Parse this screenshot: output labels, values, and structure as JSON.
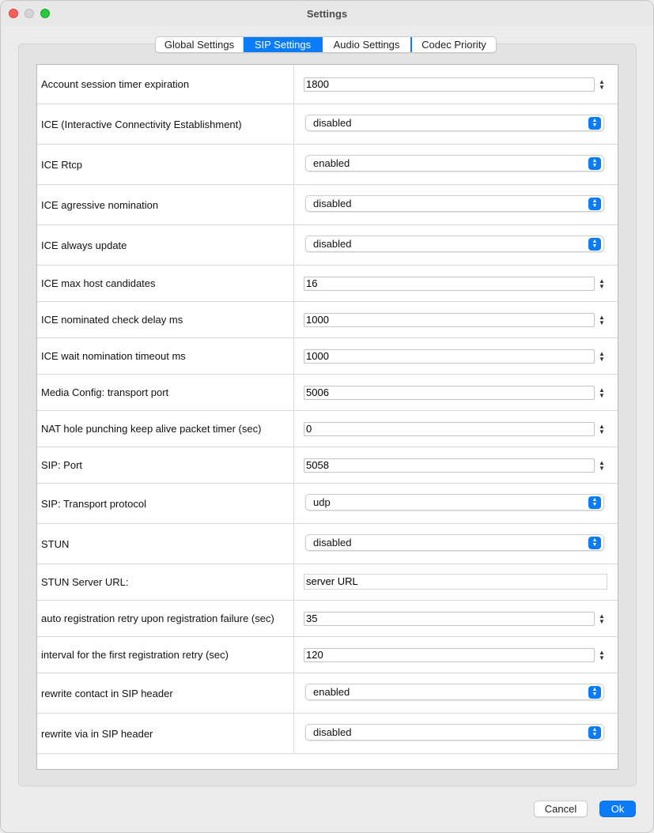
{
  "window": {
    "title": "Settings"
  },
  "tabs": [
    {
      "label": "Global Settings",
      "active": false
    },
    {
      "label": "SIP Settings",
      "active": true
    },
    {
      "label": "Audio Settings",
      "active": false
    },
    {
      "label": "Codec Priority",
      "active": false
    }
  ],
  "settings": {
    "account_session_timer": {
      "label": "Account session timer expiration",
      "value": "1800"
    },
    "ice": {
      "label": "ICE (Interactive Connectivity Establishment)",
      "value": "disabled"
    },
    "ice_rtcp": {
      "label": "ICE Rtcp",
      "value": "enabled"
    },
    "ice_aggressive": {
      "label": "ICE agressive nomination",
      "value": "disabled"
    },
    "ice_always_update": {
      "label": "ICE always update",
      "value": "disabled"
    },
    "ice_max_host": {
      "label": "ICE max host candidates",
      "value": "16"
    },
    "ice_nominated_delay": {
      "label": "ICE nominated check delay ms",
      "value": "1000"
    },
    "ice_wait_nomination": {
      "label": "ICE wait nomination timeout ms",
      "value": "1000"
    },
    "media_transport_port": {
      "label": "Media Config: transport port",
      "value": "5006"
    },
    "nat_keepalive": {
      "label": "NAT hole punching keep alive packet timer (sec)",
      "value": "0"
    },
    "sip_port": {
      "label": "SIP: Port",
      "value": "5058"
    },
    "sip_transport": {
      "label": "SIP: Transport protocol",
      "value": "udp"
    },
    "stun": {
      "label": "STUN",
      "value": "disabled"
    },
    "stun_server_url": {
      "label": "STUN Server URL:",
      "value": "server URL"
    },
    "auto_reg_retry": {
      "label": "auto registration retry upon registration failure (sec)",
      "value": "35"
    },
    "first_reg_retry": {
      "label": "interval for the first registration retry (sec)",
      "value": "120"
    },
    "rewrite_contact": {
      "label": "rewrite contact in SIP header",
      "value": "enabled"
    },
    "rewrite_via": {
      "label": "rewrite via in SIP header",
      "value": "disabled"
    }
  },
  "buttons": {
    "cancel": "Cancel",
    "ok": "Ok"
  },
  "colors": {
    "accent": "#0a7cf8",
    "close": "#fe5f57",
    "maximize": "#28c840"
  }
}
